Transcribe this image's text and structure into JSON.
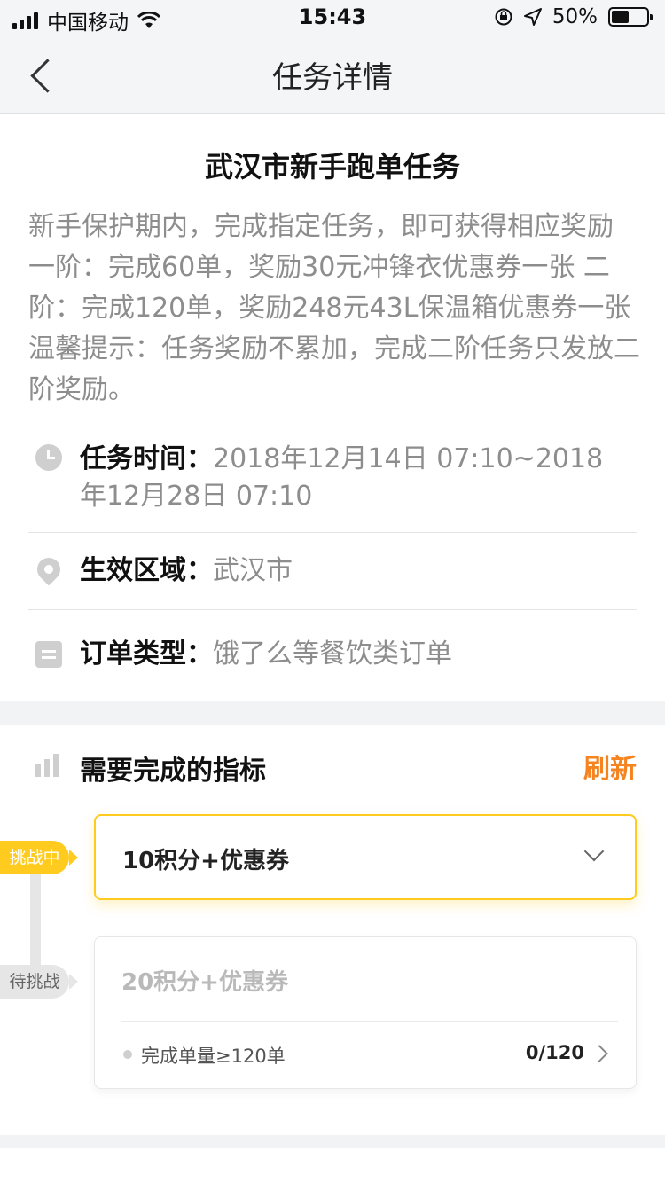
{
  "status_bar": {
    "carrier": "中国移动",
    "time": "15:43",
    "battery_text": "50%",
    "battery_level": 0.5
  },
  "nav": {
    "title": "任务详情"
  },
  "task": {
    "title": "武汉市新手跑单任务",
    "description": "新手保护期内，完成指定任务，即可获得相应奖励 一阶：完成60单，奖励30元冲锋衣优惠券一张 二阶：完成120单，奖励248元43L保温箱优惠券一张 温馨提示：任务奖励不累加，完成二阶任务只发放二阶奖励。",
    "time_label": "任务时间：",
    "time_value": "2018年12月14日 07:10~2018年12月28日 07:10",
    "area_label": "生效区域：",
    "area_value": "武汉市",
    "order_label": "订单类型：",
    "order_value": "饿了么等餐饮类订单"
  },
  "metrics": {
    "title": "需要完成的指标",
    "refresh_label": "刷新",
    "stages": [
      {
        "tag": "挑战中",
        "name": "10积分+优惠券"
      },
      {
        "tag": "待挑战",
        "name": "20积分+优惠券",
        "requirement": "完成单量≥120单",
        "progress": "0/120"
      }
    ]
  },
  "colors": {
    "accent": "#ffcb1f",
    "refresh": "#f5831f",
    "muted_text": "#8d8d8d"
  }
}
